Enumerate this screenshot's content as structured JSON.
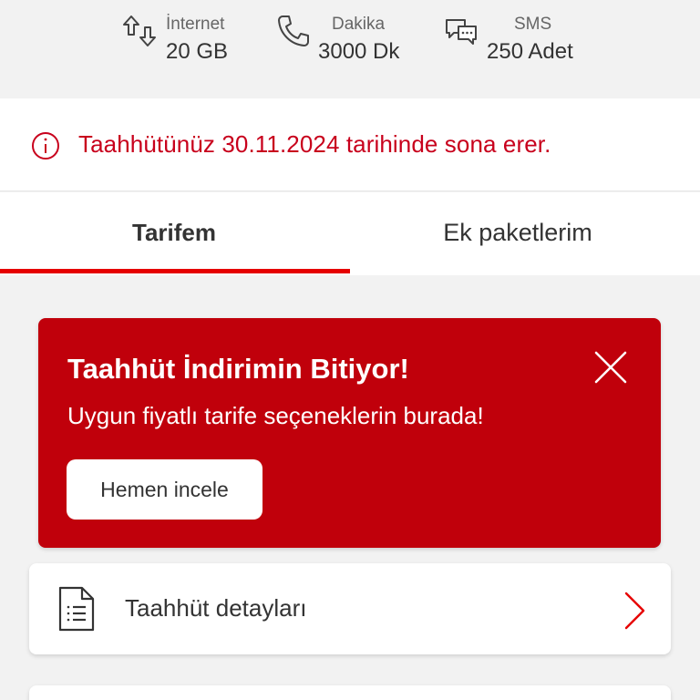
{
  "usage": {
    "internet": {
      "label": "İnternet",
      "value": "20 GB",
      "icon": "data-transfer-icon"
    },
    "minutes": {
      "label": "Dakika",
      "value": "3000 Dk",
      "icon": "phone-icon"
    },
    "sms": {
      "label": "SMS",
      "value": "250 Adet",
      "icon": "chat-bubbles-icon"
    }
  },
  "notice": {
    "text": "Taahhütünüz 30.11.2024 tarihinde sona erer.",
    "icon": "info-icon"
  },
  "tabs": [
    {
      "label": "Tarifem",
      "active": true
    },
    {
      "label": "Ek paketlerim",
      "active": false
    }
  ],
  "promo": {
    "title": "Taahhüt İndirimin Bitiyor!",
    "subtitle": "Uygun fiyatlı tarife seçeneklerin burada!",
    "button_label": "Hemen incele",
    "close_icon": "close-icon"
  },
  "list": {
    "items": [
      {
        "label": "Taahhüt detayları",
        "icon": "document-icon"
      }
    ]
  },
  "colors": {
    "accent": "#e60000",
    "promo_bg": "#c0000b",
    "notice_text": "#c8001c",
    "background": "#f2f2f2"
  }
}
